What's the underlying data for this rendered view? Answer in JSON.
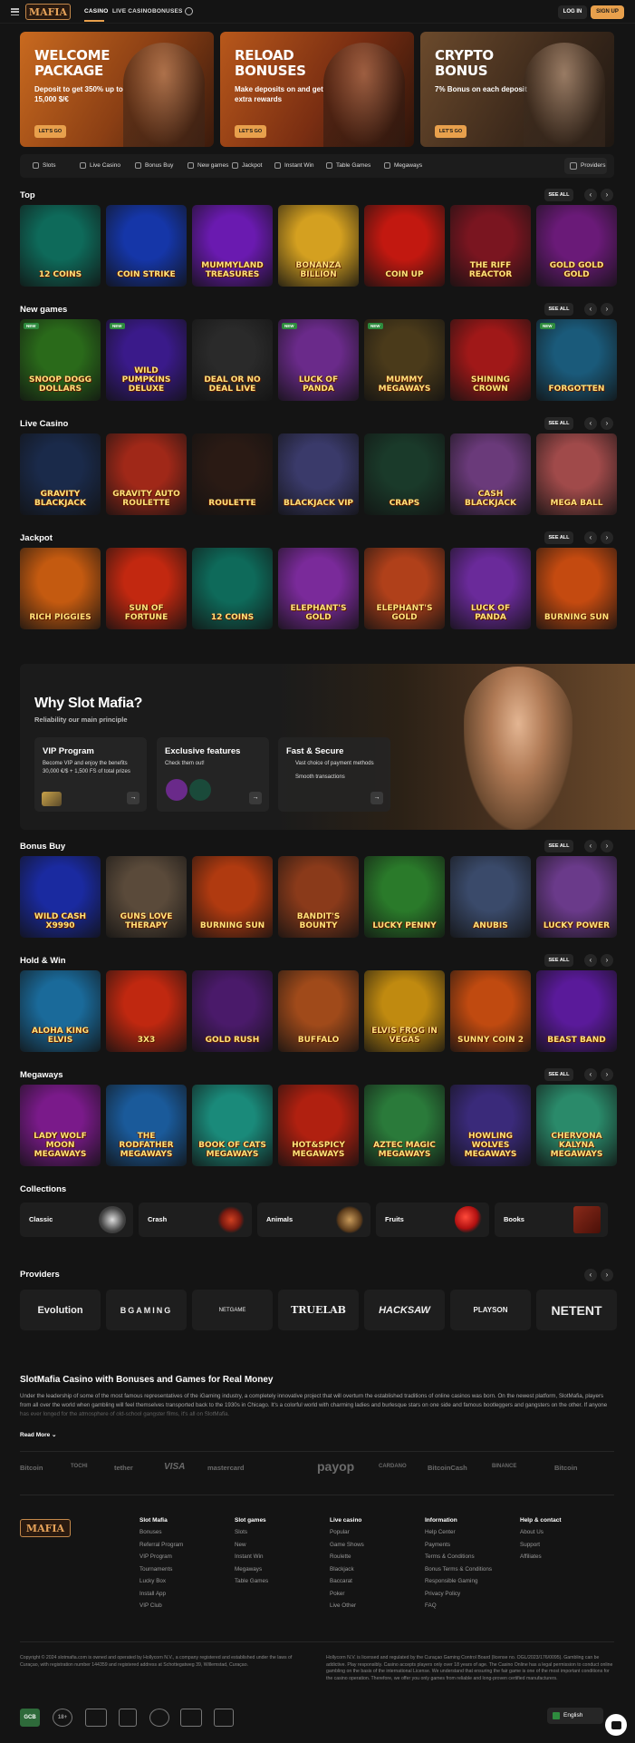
{
  "header": {
    "logo_text": "MAFIA",
    "nav": [
      "CASINO",
      "LIVE CASINO",
      "BONUSES"
    ],
    "login": "LOG IN",
    "signup": "SIGN UP"
  },
  "banners": [
    {
      "title": "WELCOME PACKAGE",
      "desc": "Deposit to get 350% up to 15,000 $/€",
      "button": "LET'S GO"
    },
    {
      "title": "RELOAD BONUSES",
      "desc": "Make deposits on and get extra rewards",
      "button": "LET'S GO"
    },
    {
      "title": "CRYPTO BONUS",
      "desc": "7% Bonus on each deposit",
      "button": "LET'S GO"
    }
  ],
  "categories": [
    "Slots",
    "Live Casino",
    "Bonus Buy",
    "New games",
    "Jackpot",
    "Instant Win",
    "Table Games",
    "Megaways"
  ],
  "providers_button": "Providers",
  "see_all": "SEE ALL",
  "sections": [
    {
      "title": "Top",
      "games": [
        "12 Coins",
        "Coin Strike",
        "Mummyland Treasures",
        "Bonanza Billion",
        "Coin Up",
        "The Riff Reactor",
        "Gold Gold Gold"
      ],
      "colors": [
        "#0e6a5a",
        "#1536a8",
        "#6a1ab0",
        "#d4a020",
        "#c21810",
        "#7a1520",
        "#6a1a78"
      ]
    },
    {
      "title": "New games",
      "games": [
        "Snoop Dogg Dollars",
        "Wild Pumpkins Deluxe",
        "Deal or No Deal Live",
        "Luck of Panda",
        "Mummy Megaways",
        "Shining Crown",
        "Forgotten"
      ],
      "colors": [
        "#2a6a1a",
        "#3a1a8a",
        "#2a2a2a",
        "#6a2a8a",
        "#4a3a1a",
        "#a01818",
        "#1a5a7a"
      ]
    },
    {
      "title": "Live Casino",
      "games": [
        "Gravity Blackjack",
        "Gravity Auto Roulette",
        "Roulette",
        "Blackjack VIP",
        "Craps",
        "Cash Blackjack",
        "Mega Ball"
      ],
      "colors": [
        "#1a2a4a",
        "#a02818",
        "#2a1a14",
        "#3a3a6a",
        "#1a3a2a",
        "#6a3a7a",
        "#a04a4a"
      ]
    },
    {
      "title": "Jackpot",
      "games": [
        "Rich Piggies",
        "Sun of Fortune",
        "12 Coins",
        "Elephant's Gold",
        "Elephant's Gold",
        "Luck of Panda",
        "Burning Sun"
      ],
      "colors": [
        "#c45a10",
        "#c22810",
        "#0e6a5a",
        "#7a2a9a",
        "#b0401a",
        "#6a2a9a",
        "#c44a10"
      ]
    },
    {
      "title": "Bonus Buy",
      "games": [
        "Wild Cash x9990",
        "Guns Love Therapy",
        "Burning Sun",
        "Bandit's Bounty",
        "Lucky Penny",
        "Anubis",
        "Lucky Power"
      ],
      "colors": [
        "#1a2aa0",
        "#5a4a3a",
        "#b03a10",
        "#8a3a1a",
        "#2a7a2a",
        "#3a4a6a",
        "#6a3a8a"
      ]
    },
    {
      "title": "Hold & Win",
      "games": [
        "Aloha King Elvis",
        "3x3",
        "Gold Rush",
        "Buffalo",
        "Elvis Frog in Vegas",
        "Sunny Coin 2",
        "Beast Band"
      ],
      "colors": [
        "#1a6a9a",
        "#c02810",
        "#4a1a6a",
        "#a04a1a",
        "#c08a10",
        "#c04a10",
        "#5a1a9a"
      ]
    },
    {
      "title": "Megaways",
      "games": [
        "Lady Wolf Moon Megaways",
        "The Rodfather Megaways",
        "Book of Cats Megaways",
        "Hot&Spicy Megaways",
        "Aztec Magic Megaways",
        "Howling Wolves Megaways",
        "Chervona Kalyna Megaways"
      ],
      "colors": [
        "#7a1a8a",
        "#1a5a9a",
        "#1a8a7a",
        "#b02010",
        "#2a7a3a",
        "#3a2a7a",
        "#2a8a6a"
      ]
    }
  ],
  "why": {
    "title": "Why Slot Mafia?",
    "subtitle": "Reliability our main principle",
    "cards": [
      {
        "title": "VIP Program",
        "desc": "Become VIP and enjoy the benefits 30,000 €/$ + 1,500 FS of total prizes"
      },
      {
        "title": "Exclusive features",
        "desc": "Check them out!"
      },
      {
        "title": "Fast & Secure",
        "desc": "Vast choice of payment methods",
        "desc2": "Smooth transactions"
      }
    ]
  },
  "collections_title": "Collections",
  "collections": [
    "Classic",
    "Crash",
    "Animals",
    "Fruits",
    "Books"
  ],
  "providers_title": "Providers",
  "providers": [
    "Evolution",
    "BGAMING",
    "NETGAME",
    "TRUELAB",
    "HACKSAW",
    "PLAYSON",
    "NETENT"
  ],
  "seo": {
    "title": "SlotMafia Casino with Bonuses and Games for Real Money",
    "text": "Under the leadership of some of the most famous representatives of the iGaming industry, a completely innovative project that will overturn the established traditions of online casinos was born. On the newest platform, SlotMafia, players from all over the world when gambling will feel themselves transported back to the 1930s in Chicago. It's a colorful world with charming ladies and burlesque stars on one side and famous bootleggers and gangsters on the other. If anyone has ever longed for the atmosphere of old-school gangster films, it's all on SlotMafia.",
    "read_more": "Read More"
  },
  "payments": [
    "Bitcoin",
    "TOCHI",
    "tether",
    "VISA",
    "mastercard",
    "payop",
    "CARDANO",
    "BitcoinCash",
    "BINANCE",
    "Bitcoin"
  ],
  "footer": {
    "columns": [
      {
        "heading": "Slot Mafia",
        "items": [
          "Bonuses",
          "Referral Program",
          "VIP Program",
          "Tournaments",
          "Lucky Box",
          "Install App",
          "VIP Club"
        ]
      },
      {
        "heading": "Slot games",
        "items": [
          "Slots",
          "New",
          "Instant Win",
          "Megaways",
          "Table Games"
        ]
      },
      {
        "heading": "Live casino",
        "items": [
          "Popular",
          "Game Shows",
          "Roulette",
          "Blackjack",
          "Baccarat",
          "Poker",
          "Live Other"
        ]
      },
      {
        "heading": "Information",
        "items": [
          "Help Center",
          "Payments",
          "Terms & Conditions",
          "Bonus Terms & Conditions",
          "Responsible Gaming",
          "Privacy Policy",
          "FAQ"
        ]
      },
      {
        "heading": "Help & contact",
        "items": [
          "About Us",
          "Support",
          "Affiliates"
        ]
      }
    ],
    "legal_left": "Copyright © 2024 slotmafia.com is owned and operated by Hollycorn N.V., a company registered and established under the laws of Curaçao, with registration number 144359 and registered address at Schottegatweg 39, Willemstad, Curaçao.",
    "legal_right": "Hollycorn N.V. is licensed and regulated by the Curaçao Gaming Control Board (license no. OGL/2023/176/0095). Gambling can be addictive. Play responsibly. Casino accepts players only over 18 years of age. The Casino Online has a legal permission to conduct online gambling on the basis of the international License. We understand that ensuring the fair game is one of the most important conditions for the casino operation. Therefore, we offer you only games from reliable and long-proven certified manufacturers.",
    "certs": [
      "GCB",
      "18+",
      "",
      "",
      "",
      "",
      ""
    ],
    "language": "English"
  }
}
